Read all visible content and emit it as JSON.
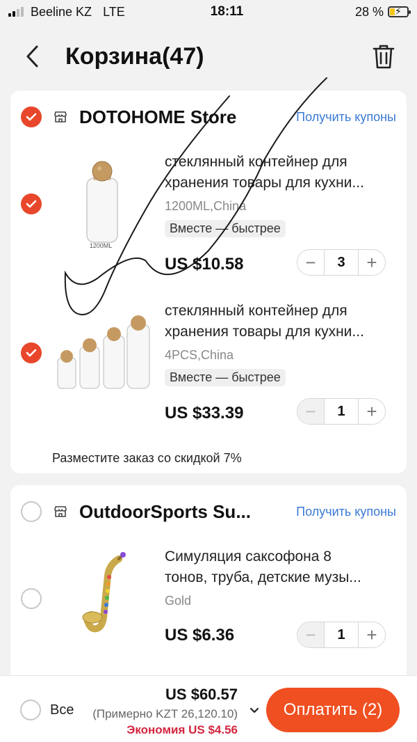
{
  "status_bar": {
    "carrier": "Beeline KZ",
    "network": "LTE",
    "time": "18:11",
    "battery": "28 %",
    "battery_level": 0.28
  },
  "header": {
    "title": "Корзина(47)",
    "back_icon": "chevron-left-icon",
    "trash_icon": "trash-icon"
  },
  "stores": [
    {
      "name": "DOTOHOME Store",
      "coupon_label": "Получить купоны",
      "selected": true,
      "items": [
        {
          "title_line1": "стеклянный контейнер для",
          "title_line2": "хранения товары для кухни...",
          "variant": "1200ML,China",
          "image_label": "1200ML",
          "tag": "Вместе — быстрее",
          "price": "US $10.58",
          "quantity": "3",
          "selected": true
        },
        {
          "title_line1": "стеклянный контейнер для",
          "title_line2": "хранения товары для кухни...",
          "variant": "4PCS,China",
          "tag": "Вместе — быстрее",
          "price": "US $33.39",
          "quantity": "1",
          "selected": true
        }
      ],
      "discount_note": "Разместите заказ со скидкой 7%"
    },
    {
      "name": "OutdoorSports Su...",
      "coupon_label": "Получить купоны",
      "selected": false,
      "items": [
        {
          "title_line1": "Симуляция саксофона 8",
          "title_line2": "тонов, труба, детские музы...",
          "variant": "Gold",
          "price": "US $6.36",
          "quantity": "1",
          "selected": false
        }
      ]
    }
  ],
  "footer": {
    "all_label": "Все",
    "total": "US $60.57",
    "approx": "(Примерно KZT 26,120.10)",
    "savings": "Экономия US $4.56",
    "pay_label": "Оплатить (2)"
  },
  "colors": {
    "accent": "#f04f21",
    "check": "#e8472b",
    "link": "#3a7ad5",
    "savings": "#d3263f"
  }
}
